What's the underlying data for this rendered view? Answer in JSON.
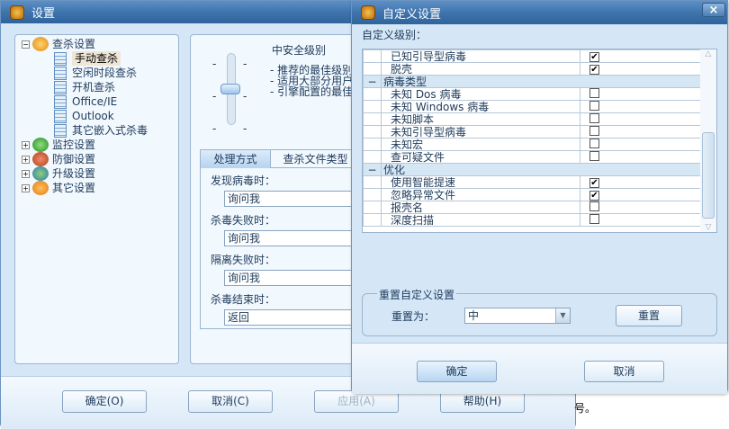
{
  "main": {
    "title": "设置",
    "tree": [
      {
        "label": "查杀设置",
        "expander": "−",
        "children": [
          "手动查杀",
          "空闲时段查杀",
          "开机查杀",
          "Office/IE",
          "Outlook",
          "其它嵌入式杀毒"
        ]
      },
      {
        "label": "监控设置",
        "expander": "+"
      },
      {
        "label": "防御设置",
        "expander": "+"
      },
      {
        "label": "升级设置",
        "expander": "+"
      },
      {
        "label": "其它设置",
        "expander": "+"
      }
    ],
    "level_title": "中安全级别",
    "level_desc": [
      "- 推荐的最佳级别",
      "- 适用大部分用户",
      "- 引擎配置的最佳"
    ],
    "tabs": [
      "处理方式",
      "查杀文件类型"
    ],
    "fields": [
      {
        "label": "发现病毒时：",
        "value": "询问我"
      },
      {
        "label": "杀毒失败时：",
        "value": "询问我"
      },
      {
        "label": "隔离失败时：",
        "value": "询问我"
      },
      {
        "label": "杀毒结束时：",
        "value": "返回"
      }
    ],
    "buttons": {
      "ok": "确定(O)",
      "cancel": "取消(C)",
      "apply": "应用(A)",
      "help": "帮助(H)"
    },
    "behind_text": "号。"
  },
  "dialog": {
    "title": "自定义设置",
    "level_label": "自定义级别：",
    "rows": [
      {
        "type": "item",
        "label": "已知引导型病毒",
        "checked": true
      },
      {
        "type": "item",
        "label": "脱壳",
        "checked": true
      },
      {
        "type": "group",
        "label": "病毒类型",
        "expander": "−"
      },
      {
        "type": "item",
        "label": "未知 Dos 病毒",
        "checked": false
      },
      {
        "type": "item",
        "label": "未知 Windows 病毒",
        "checked": false
      },
      {
        "type": "item",
        "label": "未知脚本",
        "checked": false
      },
      {
        "type": "item",
        "label": "未知引导型病毒",
        "checked": false
      },
      {
        "type": "item",
        "label": "未知宏",
        "checked": false
      },
      {
        "type": "item",
        "label": "查可疑文件",
        "checked": false
      },
      {
        "type": "group",
        "label": "优化",
        "expander": "−"
      },
      {
        "type": "item",
        "label": "使用智能提速",
        "checked": true
      },
      {
        "type": "item",
        "label": "忽略异常文件",
        "checked": true
      },
      {
        "type": "item",
        "label": "报壳名",
        "checked": false
      },
      {
        "type": "item",
        "label": "深度扫描",
        "checked": false
      }
    ],
    "reset_group": "重置自定义设置",
    "reset_label": "重置为：",
    "reset_value": "中",
    "reset_button": "重置",
    "ok": "确定",
    "cancel": "取消",
    "close": "×"
  }
}
